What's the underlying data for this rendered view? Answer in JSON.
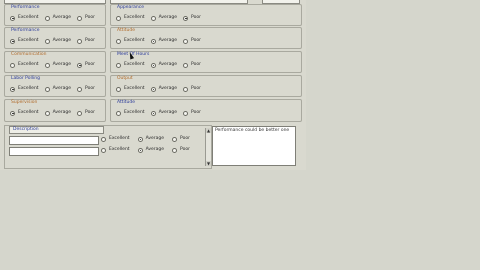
{
  "groups": [
    {
      "label": "Performance",
      "color": "blue",
      "options": [
        "Excellent",
        "Average",
        "Poor"
      ],
      "selected": 0
    },
    {
      "label": "Appearance",
      "color": "blue",
      "options": [
        "Excellent",
        "Average",
        "Poor"
      ],
      "selected": 2
    },
    {
      "label": "Performance",
      "color": "blue",
      "options": [
        "Excellent",
        "Average",
        "Poor"
      ],
      "selected": 0
    },
    {
      "label": "Attitude",
      "color": "orange",
      "options": [
        "Excellent",
        "Average",
        "Poor"
      ],
      "selected": 1
    },
    {
      "label": "Communication",
      "color": "orange",
      "options": [
        "Excellent",
        "Average",
        "Poor"
      ],
      "selected": 2
    },
    {
      "label": "Meet Of Hours",
      "color": "blue",
      "options": [
        "Excellent",
        "Average",
        "Poor"
      ],
      "selected": 1
    },
    {
      "label": "Labor Polling",
      "color": "blue",
      "options": [
        "Excellent",
        "Average",
        "Poor"
      ],
      "selected": 0
    },
    {
      "label": "Output",
      "color": "orange",
      "options": [
        "Excellent",
        "Average",
        "Poor"
      ],
      "selected": 1
    },
    {
      "label": "Supervision",
      "color": "orange",
      "options": [
        "Excellent",
        "Average",
        "Poor"
      ],
      "selected": 0
    },
    {
      "label": "Attitude",
      "color": "blue",
      "options": [
        "Excellent",
        "Average",
        "Poor"
      ],
      "selected": 1
    }
  ],
  "description": {
    "title": "Description",
    "row1": {
      "options": [
        "Excellent",
        "Average",
        "Poor"
      ],
      "selected": 1
    },
    "row2": {
      "options": [
        "Excellent",
        "Average",
        "Poor"
      ],
      "selected": 1
    }
  },
  "comment": "Performance could be better one"
}
